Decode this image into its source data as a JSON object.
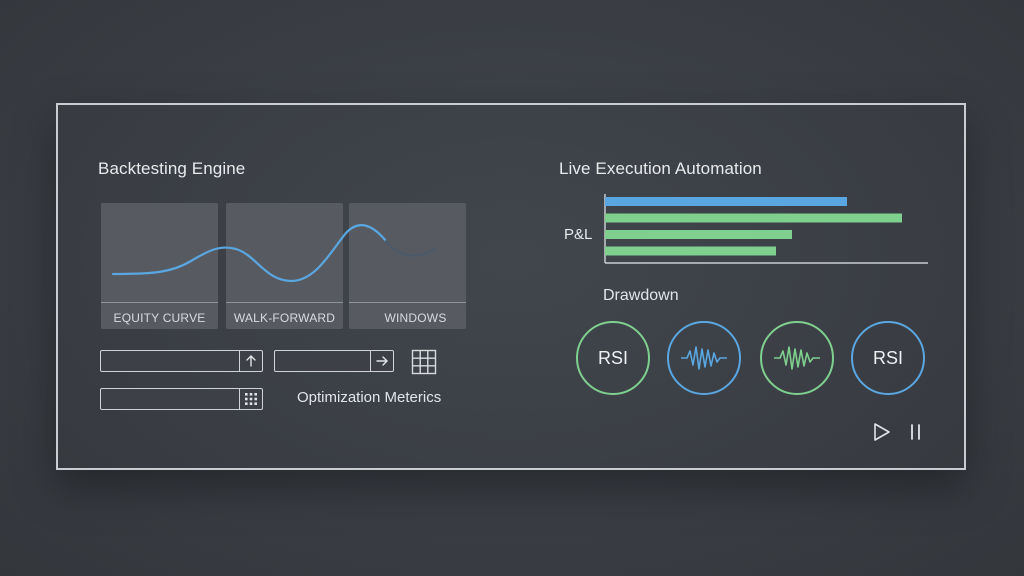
{
  "backtesting": {
    "title": "Backtesting Engine",
    "panels": [
      {
        "label": "EQUITY CURVE"
      },
      {
        "label": "WALK-FORWARD"
      },
      {
        "label": "WINDOWS"
      }
    ],
    "metrics_label": "Optimization Meterics"
  },
  "live": {
    "title": "Live Execution Automation",
    "pnl_label": "P&L",
    "pnl_bars": [
      {
        "value": 0.75,
        "color": "#5aa6e0"
      },
      {
        "value": 0.92,
        "color": "#7fcf8f"
      },
      {
        "value": 0.58,
        "color": "#7fcf8f"
      },
      {
        "value": 0.53,
        "color": "#7fcf8f"
      }
    ],
    "drawdown_label": "Drawdown",
    "indicators": [
      {
        "type": "text",
        "text": "RSI",
        "color": "#7fcf8f"
      },
      {
        "type": "wave",
        "color": "#5aa6e0"
      },
      {
        "type": "wave",
        "color": "#7fcf8f"
      },
      {
        "type": "text",
        "text": "RSI",
        "color": "#5aa6e0"
      }
    ]
  },
  "colors": {
    "accent_blue": "#5aa6e0",
    "accent_green": "#7fcf8f",
    "frame": "#c9cdd1"
  },
  "icons": {
    "upload": "arrow-up-icon",
    "go": "arrow-right-icon",
    "grid": "grid-icon",
    "keypad": "keypad-icon",
    "play": "play-icon",
    "pause": "pause-icon"
  }
}
